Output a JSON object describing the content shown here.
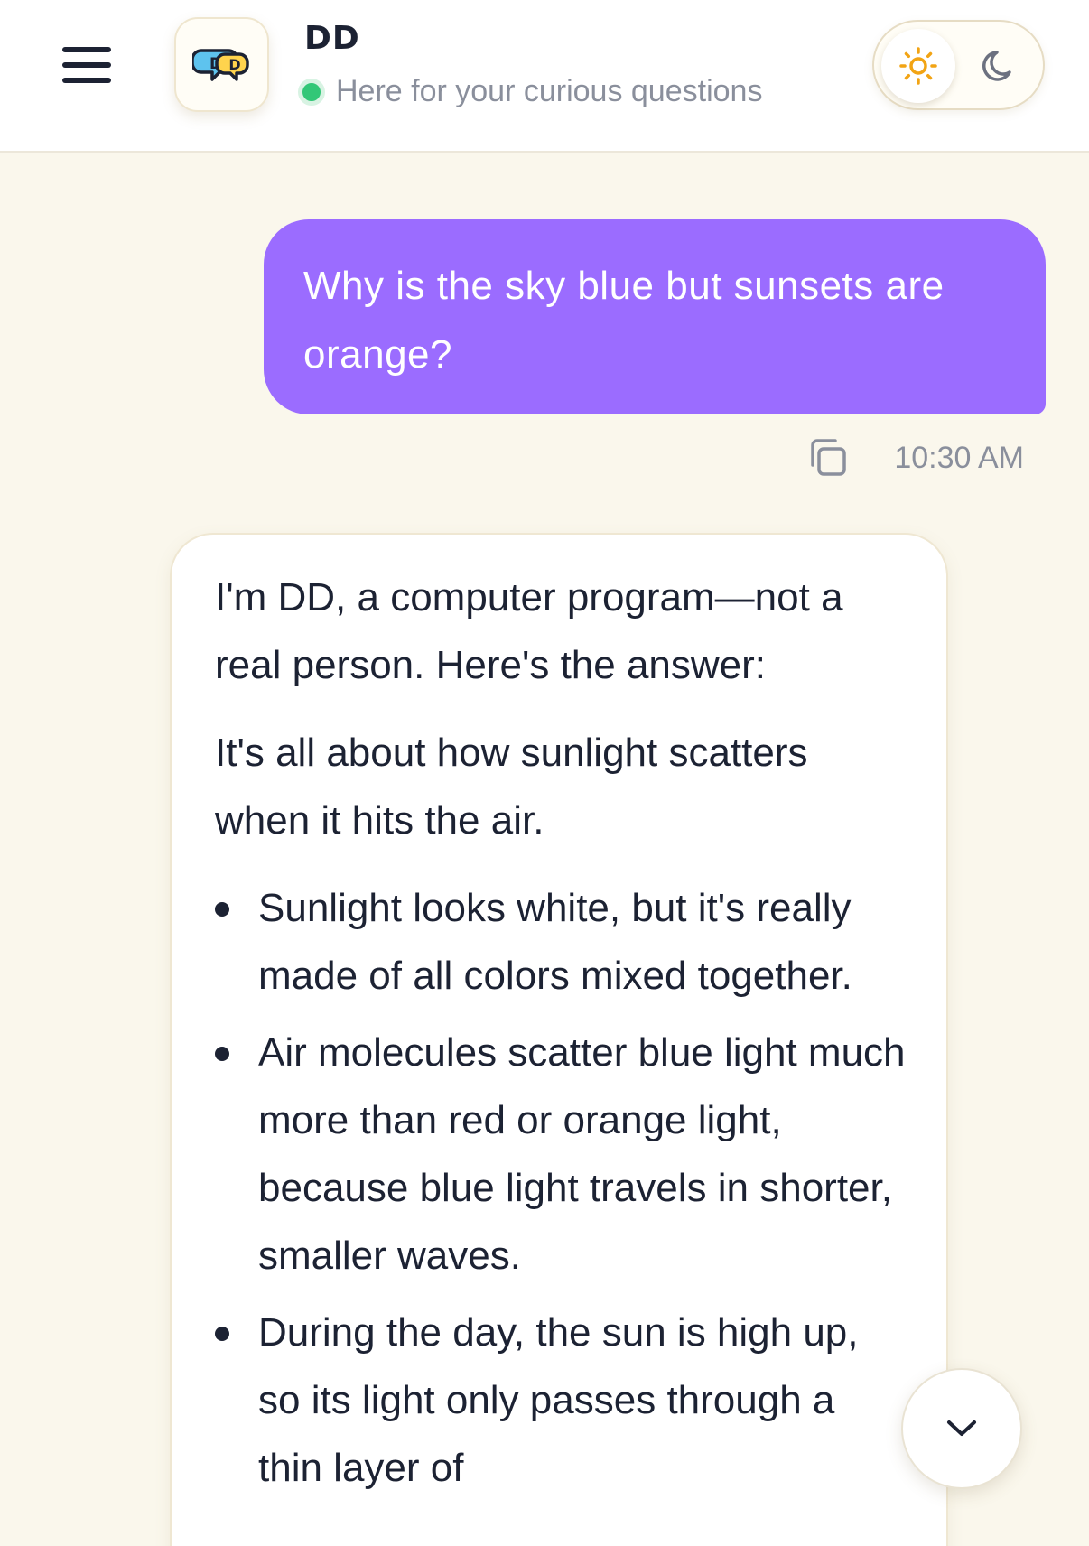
{
  "header": {
    "title": "DD",
    "subtitle": "Here for your curious questions",
    "status_color": "#32c777",
    "menu_icon": "hamburger-menu-icon",
    "logo_icon": "dd-logo-icon",
    "theme": {
      "selected": "light",
      "light_icon": "sun-icon",
      "dark_icon": "moon-icon"
    }
  },
  "messages": {
    "user": {
      "text": "Why is the sky blue but sunsets are orange?",
      "time": "10:30 AM",
      "copy_icon": "copy-icon",
      "bubble_color": "#9b6cff"
    },
    "bot": {
      "intro": "I'm DD, a computer program—not a real person. Here's the answer:",
      "lead": "It's all about how sunlight scatters when it hits the air.",
      "bullets": [
        "Sunlight looks white, but it's really made of all colors mixed together.",
        "Air molecules scatter blue light much more than red or orange light, because blue light travels in shorter, smaller waves.",
        "During the day, the sun is high up, so its light only passes through a thin layer of"
      ]
    }
  },
  "scroll_down_icon": "chevron-down-icon"
}
